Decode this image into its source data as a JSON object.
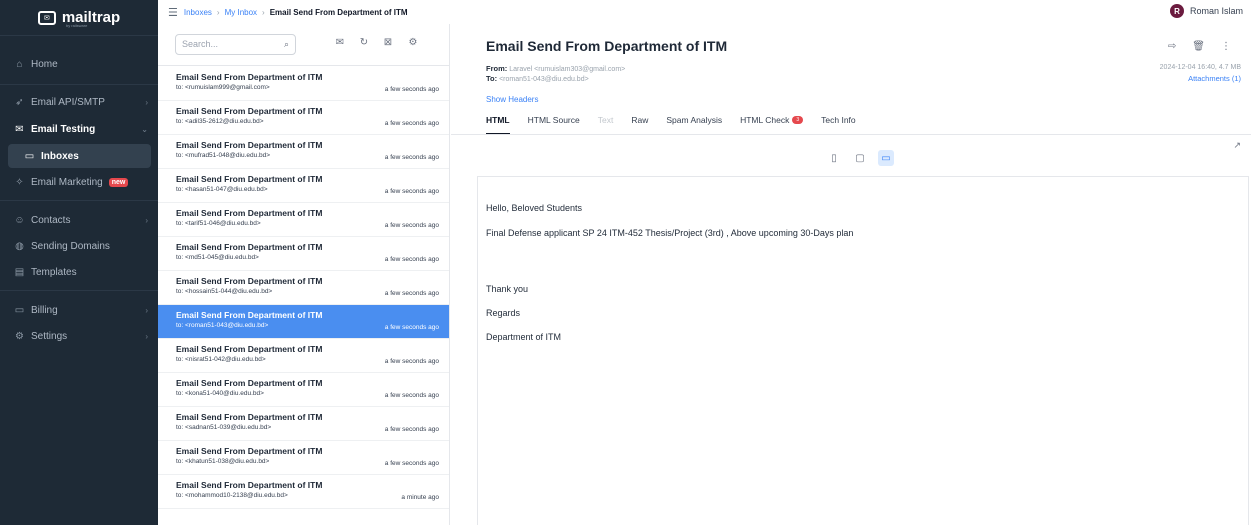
{
  "sidebar": {
    "logo": "mailtrap",
    "logo_sub": "by railsware",
    "items": [
      {
        "label": "Home",
        "icon": "home-icon"
      },
      {
        "label": "Email API/SMTP",
        "icon": "send-icon"
      },
      {
        "label": "Email Testing",
        "icon": "mail-test-icon"
      },
      {
        "label": "Inboxes",
        "icon": "inbox-icon"
      },
      {
        "label": "Email Marketing",
        "icon": "marketing-icon",
        "badge": "new"
      },
      {
        "label": "Contacts",
        "icon": "contacts-icon"
      },
      {
        "label": "Sending Domains",
        "icon": "globe-icon"
      },
      {
        "label": "Templates",
        "icon": "template-icon"
      },
      {
        "label": "Billing",
        "icon": "billing-icon"
      },
      {
        "label": "Settings",
        "icon": "gear-icon"
      }
    ]
  },
  "topbar": {
    "crumbs": [
      "Inboxes",
      "My Inbox"
    ],
    "current": "Email Send From Department of ITM",
    "user_initial": "R",
    "user_name": "Roman Islam"
  },
  "list": {
    "search_placeholder": "Search...",
    "messages": [
      {
        "subject": "Email Send From Department of ITM",
        "to": "to: <rumuislam999@gmail.com>",
        "time": "a few seconds ago"
      },
      {
        "subject": "Email Send From Department of ITM",
        "to": "to: <adil35-2612@diu.edu.bd>",
        "time": "a few seconds ago"
      },
      {
        "subject": "Email Send From Department of ITM",
        "to": "to: <mufrad51-048@diu.edu.bd>",
        "time": "a few seconds ago"
      },
      {
        "subject": "Email Send From Department of ITM",
        "to": "to: <hasan51-047@diu.edu.bd>",
        "time": "a few seconds ago"
      },
      {
        "subject": "Email Send From Department of ITM",
        "to": "to: <tarif51-046@diu.edu.bd>",
        "time": "a few seconds ago"
      },
      {
        "subject": "Email Send From Department of ITM",
        "to": "to: <md51-045@diu.edu.bd>",
        "time": "a few seconds ago"
      },
      {
        "subject": "Email Send From Department of ITM",
        "to": "to: <hossain51-044@diu.edu.bd>",
        "time": "a few seconds ago"
      },
      {
        "subject": "Email Send From Department of ITM",
        "to": "to: <roman51-043@diu.edu.bd>",
        "time": "a few seconds ago"
      },
      {
        "subject": "Email Send From Department of ITM",
        "to": "to: <nisrat51-042@diu.edu.bd>",
        "time": "a few seconds ago"
      },
      {
        "subject": "Email Send From Department of ITM",
        "to": "to: <kona51-040@diu.edu.bd>",
        "time": "a few seconds ago"
      },
      {
        "subject": "Email Send From Department of ITM",
        "to": "to: <sadnan51-039@diu.edu.bd>",
        "time": "a few seconds ago"
      },
      {
        "subject": "Email Send From Department of ITM",
        "to": "to: <khatun51-038@diu.edu.bd>",
        "time": "a few seconds ago"
      },
      {
        "subject": "Email Send From Department of ITM",
        "to": "to: <mohammod10-2138@diu.edu.bd>",
        "time": "a minute ago"
      }
    ]
  },
  "detail": {
    "title": "Email Send From Department of ITM",
    "from_label": "From:",
    "from_value": "Laravel <rumuislam303@gmail.com>",
    "to_label": "To:",
    "to_value": "<roman51-043@diu.edu.bd>",
    "date_size": "2024-12-04 16:40, 4.7 MB",
    "attachments": "Attachments (1)",
    "show_headers": "Show Headers",
    "tabs": [
      {
        "label": "HTML"
      },
      {
        "label": "HTML Source"
      },
      {
        "label": "Text"
      },
      {
        "label": "Raw"
      },
      {
        "label": "Spam Analysis"
      },
      {
        "label": "HTML Check",
        "count": "3"
      },
      {
        "label": "Tech Info"
      }
    ],
    "body": {
      "greeting": "Hello, Beloved Students",
      "line1": "Final Defense applicant SP 24 ITM-452 Thesis/Project (3rd) , Above upcoming 30-Days plan",
      "thanks": "Thank you",
      "regards": "Regards",
      "signature": "Department of ITM"
    }
  },
  "colors": {
    "sidebar_bg": "#1e2a36",
    "selected_row": "#4a8ef0",
    "link": "#3b82f6",
    "badge": "#e5484d"
  }
}
